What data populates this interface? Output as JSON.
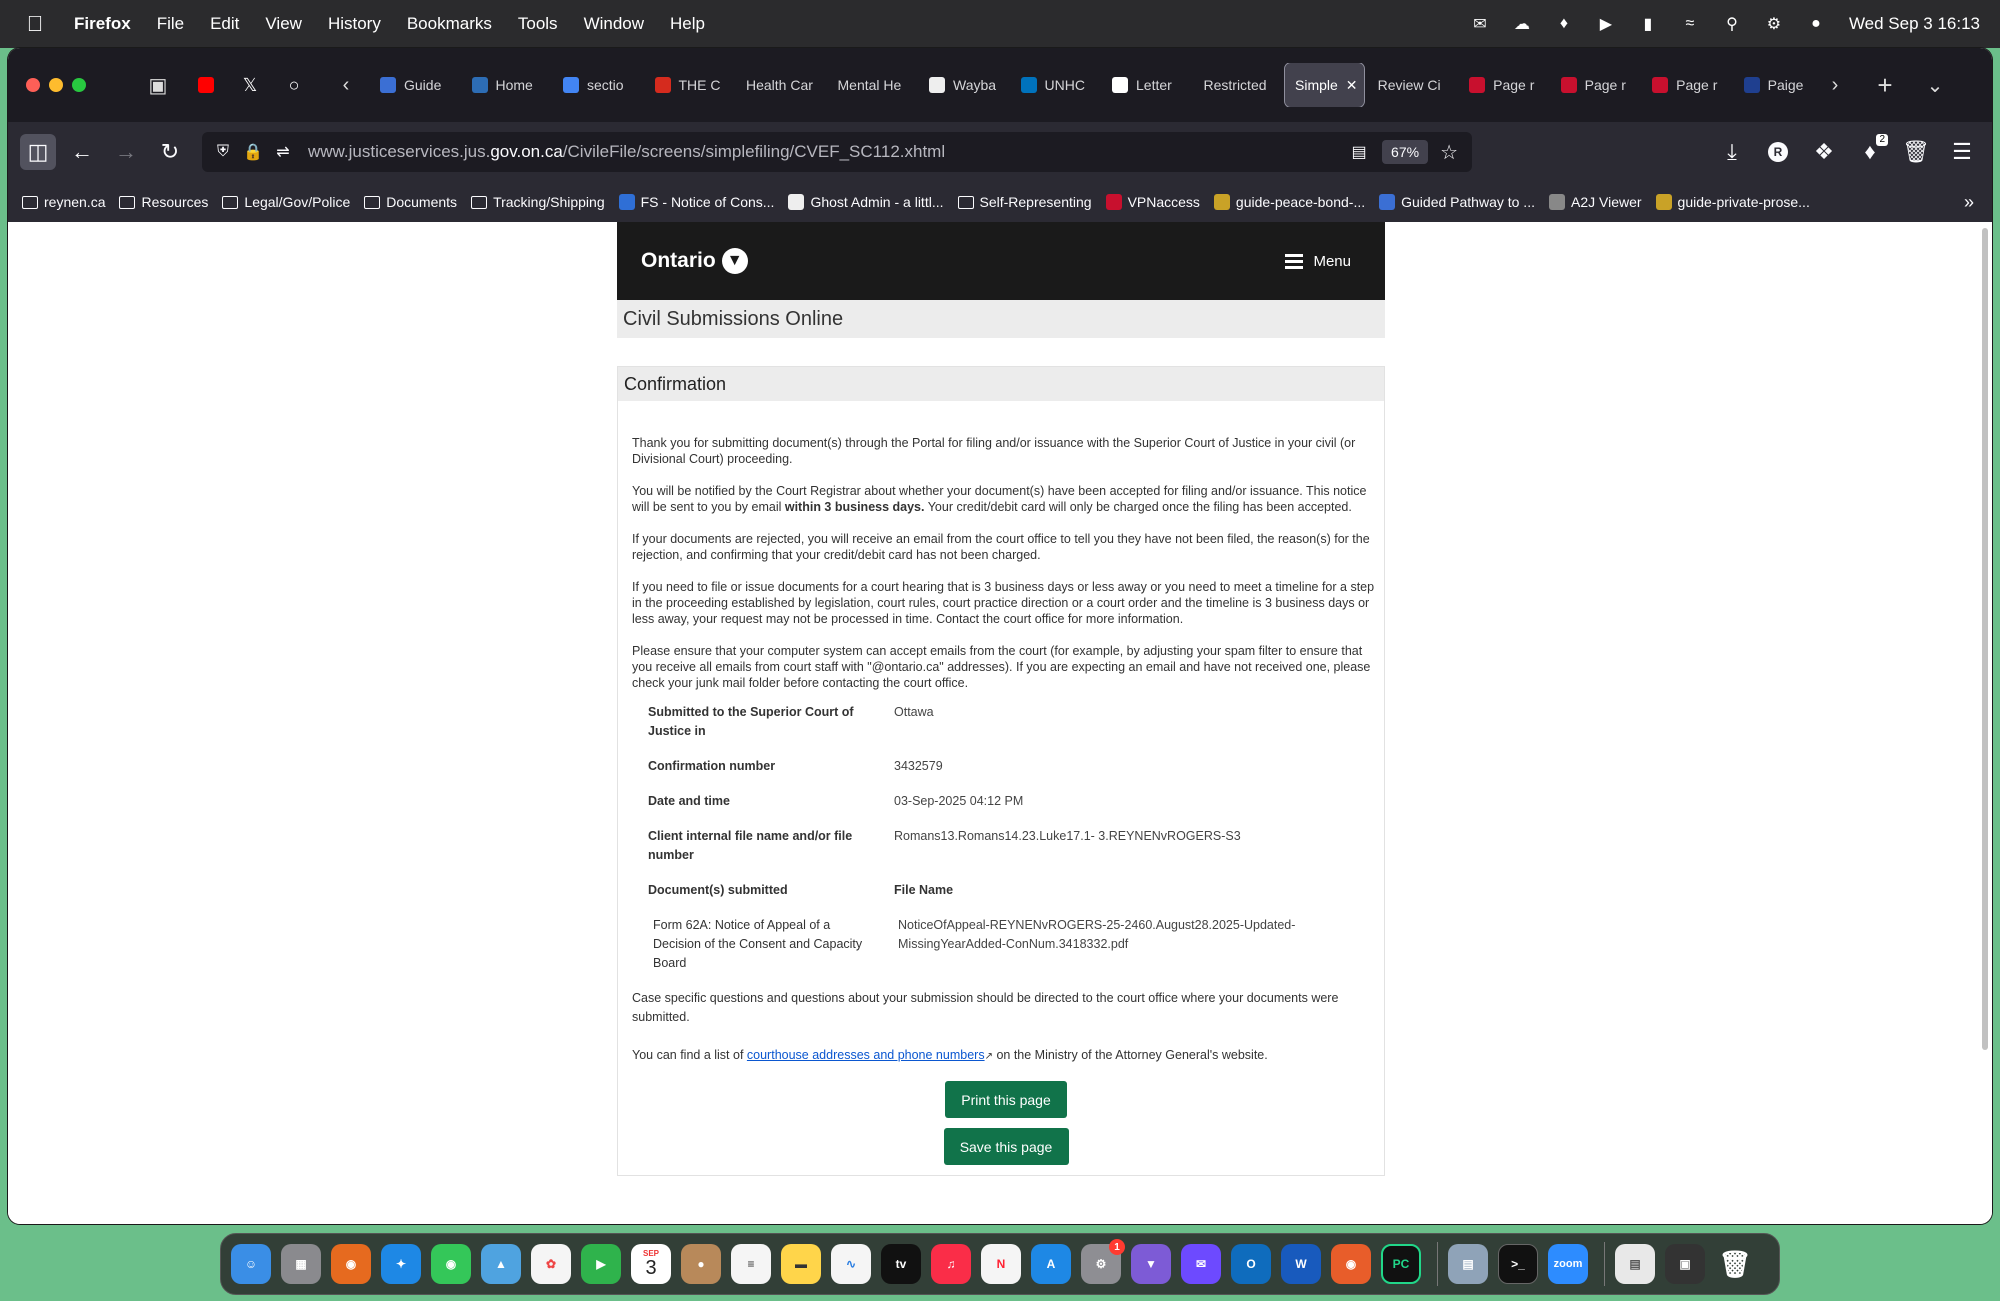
{
  "menubar": {
    "app": "Firefox",
    "items": [
      "File",
      "Edit",
      "View",
      "History",
      "Bookmarks",
      "Tools",
      "Window",
      "Help"
    ],
    "clock": "Wed Sep 3  16:13"
  },
  "tabs": [
    {
      "label": "Guide",
      "color": "#3b6fd4"
    },
    {
      "label": "Home",
      "color": "#2d6db5"
    },
    {
      "label": "sectio",
      "color": "#4285f4"
    },
    {
      "label": "THE C",
      "color": "#d52b1e"
    },
    {
      "label": "Health Car",
      "color": ""
    },
    {
      "label": "Mental He",
      "color": ""
    },
    {
      "label": "Wayba",
      "color": "#eeeeee"
    },
    {
      "label": "UNHC",
      "color": "#0072bc"
    },
    {
      "label": "Letter",
      "color": "#ffffff"
    },
    {
      "label": "Restricted",
      "color": ""
    },
    {
      "label": "Simple",
      "color": "",
      "active": true
    },
    {
      "label": "Review Ci",
      "color": ""
    },
    {
      "label": "Page r",
      "color": "#c8102e"
    },
    {
      "label": "Page r",
      "color": "#c8102e"
    },
    {
      "label": "Page r",
      "color": "#c8102e"
    },
    {
      "label": "Paige",
      "color": "#1f3f8f"
    }
  ],
  "navbar": {
    "url_host": "www.justiceservices.jus.",
    "url_domain": "gov.on.ca",
    "url_path": "/CivileFile/screens/simplefiling/CVEF_SC112.xhtml",
    "zoom": "67%",
    "extension_badge": "2"
  },
  "bookmarks": [
    {
      "label": "reynen.ca",
      "type": "folder"
    },
    {
      "label": "Resources",
      "type": "folder"
    },
    {
      "label": "Legal/Gov/Police",
      "type": "folder"
    },
    {
      "label": "Documents",
      "type": "folder"
    },
    {
      "label": "Tracking/Shipping",
      "type": "folder"
    },
    {
      "label": "FS - Notice of Cons...",
      "type": "site",
      "color": "#2f6fd6"
    },
    {
      "label": "Ghost Admin - a littl...",
      "type": "site",
      "color": "#eeeeee"
    },
    {
      "label": "Self-Representing",
      "type": "folder"
    },
    {
      "label": "VPNaccess",
      "type": "site",
      "color": "#c8102e"
    },
    {
      "label": "guide-peace-bond-...",
      "type": "site",
      "color": "#c9a227"
    },
    {
      "label": "Guided Pathway to ...",
      "type": "site",
      "color": "#3b6fd4"
    },
    {
      "label": "A2J Viewer",
      "type": "site",
      "color": "#888888"
    },
    {
      "label": "guide-private-prose...",
      "type": "site",
      "color": "#c9a227"
    }
  ],
  "page": {
    "logo": "Ontario",
    "menu_label": "Menu",
    "site_title": "Civil Submissions Online",
    "section_title": "Confirmation",
    "paragraphs": {
      "p1": "Thank you for submitting document(s) through the Portal for filing and/or issuance with the Superior Court of Justice in your civil (or Divisional Court) proceeding.",
      "p2_a": "You will be notified by the Court Registrar about whether your document(s) have been accepted for filing and/or issuance. This notice will be sent to you by email ",
      "p2_bold": "within 3 business days.",
      "p2_b": " Your credit/debit card will only be charged once the filing has been accepted.",
      "p3": "If your documents are rejected, you will receive an email from the court office to tell you they have not been filed, the reason(s) for the rejection, and confirming that your credit/debit card has not been charged.",
      "p4": "If you need to file or issue documents for a court hearing that is 3 business days or less away or you need to meet a timeline for a step in the proceeding established by legislation, court rules, court practice direction or a court order and the timeline is 3 business days or less away, your request may not be processed in time. Contact the court office for more information.",
      "p5": "Please ensure that your computer system can accept emails from the court (for example, by adjusting your spam filter to ensure that you receive all emails from court staff with \"@ontario.ca\" addresses). If you are expecting an email and have not received one, please check your junk mail folder before contacting the court office."
    },
    "details": {
      "court_label": "Submitted to the Superior Court of Justice in",
      "court_value": "Ottawa",
      "confnum_label": "Confirmation number",
      "confnum_value": "3432579",
      "datetime_label": "Date and time",
      "datetime_value": "03-Sep-2025 04:12 PM",
      "client_label": "Client internal file name and/or file number",
      "client_value": "Romans13.Romans14.23.Luke17.1- 3.REYNENvROGERS-S3",
      "docs_label": "Document(s) submitted",
      "filename_label": "File Name",
      "doc_name": "Form 62A: Notice of Appeal of a Decision of the Consent and Capacity Board",
      "doc_file": "NoticeOfAppeal-REYNENvROGERS-25-2460.August28.2025-Updated-MissingYearAdded-ConNum.3418332.pdf"
    },
    "case_text": "Case specific questions and questions about your submission should be directed to the court office where your documents were submitted.",
    "find_prefix": "You can find a list of ",
    "find_link": "courthouse addresses and phone numbers",
    "find_suffix": " on the Ministry of the Attorney General's website.",
    "print_button": "Print this page",
    "save_button": "Save this page"
  },
  "dock": {
    "calendar_month": "SEP",
    "calendar_day": "3",
    "settings_badge": "1",
    "appletv_label": "tv",
    "zoom_label": "zoom",
    "pycharm_label": "PC"
  }
}
